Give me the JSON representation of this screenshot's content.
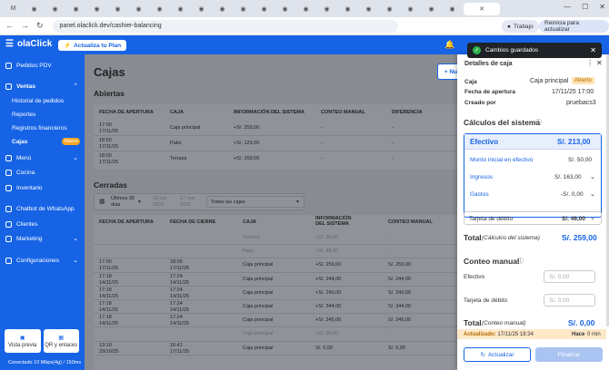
{
  "browser": {
    "url": "panel.olaclick.dev/cashier-balancing",
    "profile": "Trabajo",
    "update_label": "Reinicia para actualizar",
    "tab_icons": [
      "M",
      "G",
      "G",
      "G",
      "G",
      "G",
      "G",
      "G",
      "G",
      "G",
      "G",
      "G",
      "G",
      "G",
      "G",
      "G",
      "G",
      "G",
      "G"
    ]
  },
  "topbar": {
    "logo": "olaClick",
    "upgrade": "Actualiza tu Plan"
  },
  "sidebar": {
    "items": [
      {
        "label": "Pedidos PDV"
      },
      {
        "label": "Ventas"
      },
      {
        "label": "Menú"
      },
      {
        "label": "Cocina"
      },
      {
        "label": "Inventario"
      },
      {
        "label": "Chatbot de WhatsApp"
      },
      {
        "label": "Clientes"
      },
      {
        "label": "Marketing"
      },
      {
        "label": "Configuraciones"
      }
    ],
    "ventas_sub": [
      "Historial de pedidos",
      "Reportes",
      "Registros financieros",
      "Cajas"
    ],
    "badge_new": "Nuevo",
    "bottom": {
      "preview": "Vista previa",
      "qr": "QR y enlaces"
    },
    "connection": "Conectado 10 Mbps(4g) / 150ms"
  },
  "main": {
    "title": "Cajas",
    "new_button": "+ Nu",
    "abiertas_title": "Abiertas",
    "abiertas_headers": [
      "FECHA DE APERTURA",
      "CAJA",
      "INFORMACIÓN DEL SISTEMA",
      "CONTEO MANUAL",
      "DIFERENCIA"
    ],
    "abiertas_rows": [
      {
        "fecha": "17:00",
        "fecha2": "17/11/25",
        "caja": "Caja principal",
        "info": "+S/. 259,00",
        "conteo": "-",
        "dif": "-"
      },
      {
        "fecha": "18:50",
        "fecha2": "17/11/25",
        "caja": "Patio",
        "info": "+S/. 129,00",
        "conteo": "-",
        "dif": "-"
      },
      {
        "fecha": "18:00",
        "fecha2": "17/11/25",
        "caja": "Terraza",
        "info": "+S/. 269,00",
        "conteo": "-",
        "dif": "-"
      }
    ],
    "cerradas_title": "Cerradas",
    "filter": {
      "range": "Últimos 30 días",
      "from": "18 oct 2025",
      "to": "17 nov 2025",
      "select": "Todas las cajas"
    },
    "cerradas_headers": [
      "FECHA DE APERTURA",
      "FECHA DE CIERRE",
      "CAJA",
      "INFORMACIÓN DEL SISTEMA",
      "CONTEO MANUAL"
    ],
    "cerradas_rows": [
      {
        "a": "",
        "a2": "",
        "c": "",
        "c2": "",
        "caja": "Terraza",
        "info": "+S/. 30,00",
        "conteo": "-",
        "dim": true
      },
      {
        "a": "",
        "a2": "",
        "c": "",
        "c2": "",
        "caja": "Patio",
        "info": "+S/. 48,00",
        "conteo": "-",
        "dim": true
      },
      {
        "a": "17:00",
        "a2": "17/11/25",
        "c": "18:06",
        "c2": "17/11/25",
        "caja": "Caja principal",
        "info": "+S/. 259,00",
        "conteo": "S/. 259,00",
        "dim": false
      },
      {
        "a": "17:18",
        "a2": "14/11/25",
        "c": "17:24",
        "c2": "14/11/25",
        "caja": "Caja principal",
        "info": "+S/. 244,00",
        "conteo": "S/. 244,00",
        "dim": false
      },
      {
        "a": "17:18",
        "a2": "14/11/25",
        "c": "17:24",
        "c2": "14/11/25",
        "caja": "Caja principal",
        "info": "+S/. 240,00",
        "conteo": "S/. 240,00",
        "dim": false
      },
      {
        "a": "17:18",
        "a2": "14/11/25",
        "c": "17:24",
        "c2": "14/11/25",
        "caja": "Caja principal",
        "info": "+S/. 344,00",
        "conteo": "S/. 344,00",
        "dim": false
      },
      {
        "a": "17:18",
        "a2": "14/11/25",
        "c": "17:24",
        "c2": "14/11/25",
        "caja": "Caja principal",
        "info": "+S/. 245,00",
        "conteo": "S/. 245,00",
        "dim": false
      },
      {
        "a": "",
        "a2": "",
        "c": "",
        "c2": "",
        "caja": "Caja principal",
        "info": "+S/. 39,00",
        "conteo": "-",
        "dim": true
      },
      {
        "a": "13:10",
        "a2": "29/10/25",
        "c": "16:41",
        "c2": "17/11/25",
        "caja": "Caja principal",
        "info": "S/. 0,00",
        "conteo": "S/. 0,00",
        "dim": false
      }
    ]
  },
  "toast": {
    "message": "Cambios guardados"
  },
  "panel": {
    "title": "Detalles de caja",
    "caja_label": "Caja",
    "caja_value": "Caja principal",
    "status": "Abierto",
    "apertura_label": "Fecha de apertura",
    "apertura_value": "17/11/25 17:00",
    "creado_label": "Creado por",
    "creado_value": "pruebacs3",
    "calculos_title": "Cálculos del sistema",
    "efectivo_label": "Efectivo",
    "efectivo_value": "S/. 213,00",
    "monto_label": "Monto inicial en efectivo",
    "monto_value": "S/. 50,00",
    "ingresos_label": "Ingresos",
    "ingresos_value": "S/. 163,00",
    "gastos_label": "Gastos",
    "gastos_value": "-S/. 0,00",
    "tarjeta_label": "Tarjeta de débito",
    "tarjeta_value": "S/. 46,00",
    "total_label": "Total",
    "total_note": "(Cálculos del sistema)",
    "total_value": "S/. 259,00",
    "conteo_title": "Conteo manual",
    "conteo_efectivo": "Efectivo",
    "conteo_tarjeta": "Tarjeta de débito",
    "placeholder": "S/. 0,00",
    "conteo_total_label": "Total",
    "conteo_total_note": "(Conteo manual)",
    "conteo_total_value": "S/. 0,00",
    "actualizado_label": "Actualizado:",
    "actualizado_value": "17/11/25 18:34",
    "hace_label": "Hace",
    "hace_value": "0 min",
    "btn_actualizar": "Actualizar",
    "btn_finalizar": "Finalizar"
  }
}
